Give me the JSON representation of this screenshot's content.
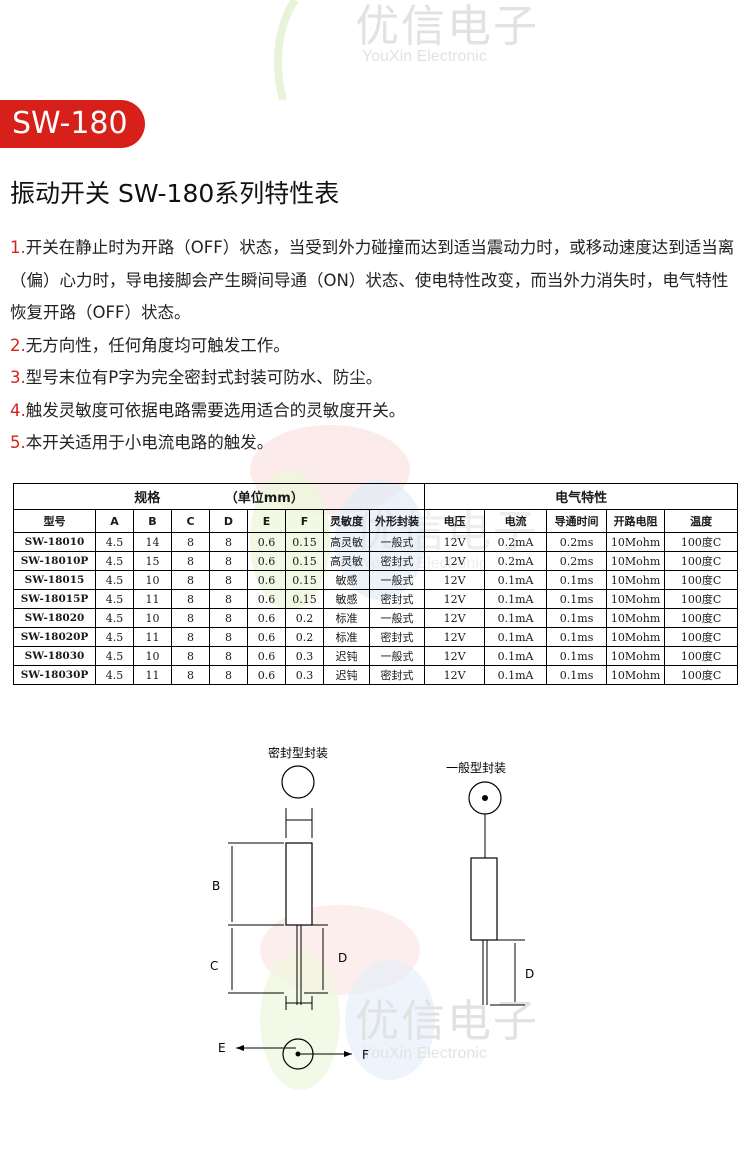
{
  "watermark": {
    "cn": "优信电子",
    "en": "YouXin Electronic"
  },
  "badge": "SW-180",
  "title": "振动开关 SW-180系列特性表",
  "features": [
    {
      "num": "1.",
      "text": "开关在静止时为开路（OFF）状态，当受到外力碰撞而达到适当震动力时，或移动速度达到适当离（偏）心力时，导电接脚会产生瞬间导通（ON）状态、使电特性改变，而当外力消失时，电气特性恢复开路（OFF）状态。"
    },
    {
      "num": "2.",
      "text": "无方向性，任何角度均可触发工作。"
    },
    {
      "num": "3.",
      "text": "型号末位有P字为完全密封式封装可防水、防尘。"
    },
    {
      "num": "4.",
      "text": "触发灵敏度可依据电路需要选用适合的灵敏度开关。"
    },
    {
      "num": "5.",
      "text": "本开关适用于小电流电路的触发。"
    }
  ],
  "table": {
    "group_spec": "规格",
    "group_unit": "（单位mm）",
    "group_elec": "电气特性",
    "headers": [
      "型号",
      "A",
      "B",
      "C",
      "D",
      "E",
      "F",
      "灵敏度",
      "外形封装",
      "电压",
      "电流",
      "导通时间",
      "开路电阻",
      "温度"
    ],
    "rows": [
      [
        "SW-18010",
        "4.5",
        "14",
        "8",
        "8",
        "0.6",
        "0.15",
        "高灵敏",
        "一般式",
        "12V",
        "0.2mA",
        "0.2ms",
        "10Mohm",
        "100度C"
      ],
      [
        "SW-18010P",
        "4.5",
        "15",
        "8",
        "8",
        "0.6",
        "0.15",
        "高灵敏",
        "密封式",
        "12V",
        "0.2mA",
        "0.2ms",
        "10Mohm",
        "100度C"
      ],
      [
        "SW-18015",
        "4.5",
        "10",
        "8",
        "8",
        "0.6",
        "0.15",
        "敏感",
        "一般式",
        "12V",
        "0.1mA",
        "0.1ms",
        "10Mohm",
        "100度C"
      ],
      [
        "SW-18015P",
        "4.5",
        "11",
        "8",
        "8",
        "0.6",
        "0.15",
        "敏感",
        "密封式",
        "12V",
        "0.1mA",
        "0.1ms",
        "10Mohm",
        "100度C"
      ],
      [
        "SW-18020",
        "4.5",
        "10",
        "8",
        "8",
        "0.6",
        "0.2",
        "标准",
        "一般式",
        "12V",
        "0.1mA",
        "0.1ms",
        "10Mohm",
        "100度C"
      ],
      [
        "SW-18020P",
        "4.5",
        "11",
        "8",
        "8",
        "0.6",
        "0.2",
        "标准",
        "密封式",
        "12V",
        "0.1mA",
        "0.1ms",
        "10Mohm",
        "100度C"
      ],
      [
        "SW-18030",
        "4.5",
        "10",
        "8",
        "8",
        "0.6",
        "0.3",
        "迟钝",
        "一般式",
        "12V",
        "0.1mA",
        "0.1ms",
        "10Mohm",
        "100度C"
      ],
      [
        "SW-18030P",
        "4.5",
        "11",
        "8",
        "8",
        "0.6",
        "0.3",
        "迟钝",
        "密封式",
        "12V",
        "0.1mA",
        "0.1ms",
        "10Mohm",
        "100度C"
      ]
    ]
  },
  "diagram": {
    "sealed_label": "密封型封装",
    "general_label": "一般型封装",
    "dims": {
      "b": "B",
      "c": "C",
      "d": "D",
      "d2": "D",
      "e": "E",
      "f": "F"
    }
  },
  "colors": {
    "accent": "#d7201a"
  }
}
